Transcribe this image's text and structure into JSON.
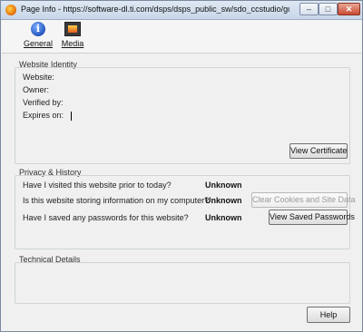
{
  "window": {
    "title": "Page Info - https://software-dl.ti.com/dsps/dsps_public_sw/sdo_ccstudio/gcc/Updates/...",
    "minimize_label": "‒",
    "maximize_label": "□",
    "close_label": "✕"
  },
  "toolbar": {
    "items": [
      {
        "label": "General",
        "icon": "info-icon"
      },
      {
        "label": "Media",
        "icon": "media-icon"
      }
    ]
  },
  "identity": {
    "heading": "Website Identity",
    "website_label": "Website:",
    "owner_label": "Owner:",
    "verified_label": "Verified by:",
    "expires_label": "Expires on:",
    "view_certificate_label": "View Certificate"
  },
  "privacy": {
    "heading": "Privacy & History",
    "rows": [
      {
        "question": "Have I visited this website prior to today?",
        "value": "Unknown"
      },
      {
        "question": "Is this website storing information on my computer?",
        "value": "Unknown",
        "button": "Clear Cookies and Site Data"
      },
      {
        "question": "Have I saved any passwords for this website?",
        "value": "Unknown",
        "button": "View Saved Passwords"
      }
    ]
  },
  "technical": {
    "heading": "Technical Details"
  },
  "footer": {
    "help_label": "Help"
  }
}
